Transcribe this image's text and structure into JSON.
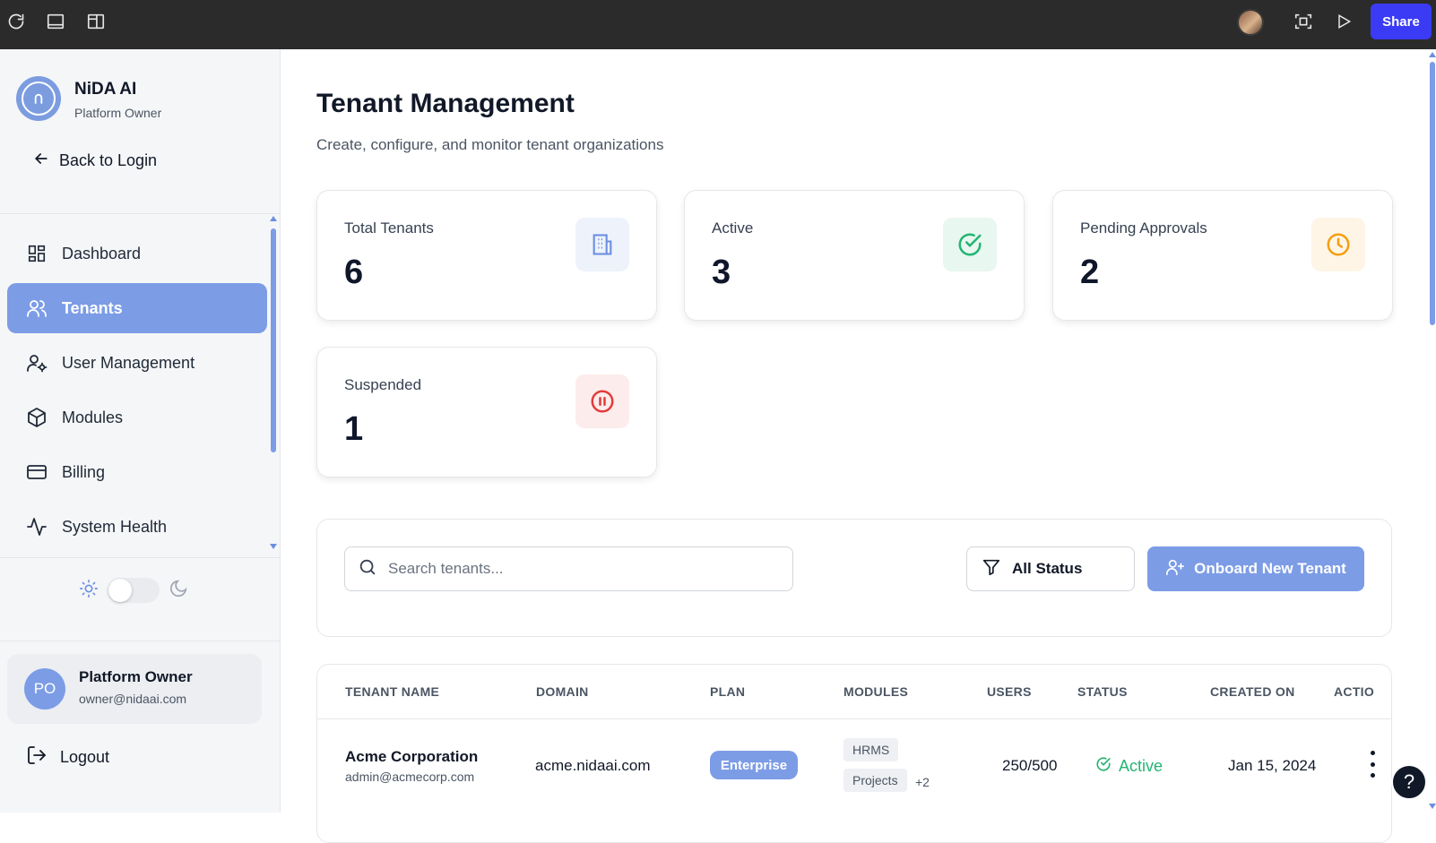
{
  "topbar": {
    "share_label": "Share",
    "icons": [
      "reload-icon",
      "panel-icon",
      "layout-icon",
      "profile-avatar",
      "screenshot-icon",
      "play-icon"
    ]
  },
  "sidebar": {
    "brand_name": "NiDA AI",
    "brand_role": "Platform Owner",
    "back_label": "Back to Login",
    "items": [
      {
        "label": "Dashboard",
        "icon": "dashboard-icon",
        "active": false
      },
      {
        "label": "Tenants",
        "icon": "users-icon",
        "active": true
      },
      {
        "label": "User Management",
        "icon": "user-gear-icon",
        "active": false
      },
      {
        "label": "Modules",
        "icon": "box-icon",
        "active": false
      },
      {
        "label": "Billing",
        "icon": "credit-card-icon",
        "active": false
      },
      {
        "label": "System Health",
        "icon": "activity-icon",
        "active": false
      }
    ],
    "theme": "light",
    "user": {
      "initials": "PO",
      "name": "Platform Owner",
      "email": "owner@nidaai.com"
    },
    "logout_label": "Logout"
  },
  "main": {
    "title": "Tenant Management",
    "subtitle": "Create, configure, and monitor tenant organizations",
    "stats": [
      {
        "label": "Total Tenants",
        "value": "6",
        "icon": "building-icon",
        "color": "#6b8fe0",
        "bg": "#eef2fb"
      },
      {
        "label": "Active",
        "value": "3",
        "icon": "check-circle-icon",
        "color": "#22b573",
        "bg": "#e8f7f0"
      },
      {
        "label": "Pending Approvals",
        "value": "2",
        "icon": "clock-icon",
        "color": "#f59e0b",
        "bg": "#fef5e7"
      },
      {
        "label": "Suspended",
        "value": "1",
        "icon": "pause-circle-icon",
        "color": "#e23b3b",
        "bg": "#fdecec"
      }
    ],
    "search": {
      "placeholder": "Search tenants...",
      "value": ""
    },
    "status_filter": "All Status",
    "onboard_label": "Onboard New Tenant",
    "table": {
      "columns": [
        "TENANT NAME",
        "DOMAIN",
        "PLAN",
        "MODULES",
        "USERS",
        "STATUS",
        "CREATED ON",
        "ACTIO"
      ],
      "rows": [
        {
          "name": "Acme Corporation",
          "email": "admin@acmecorp.com",
          "domain": "acme.nidaai.com",
          "plan": "Enterprise",
          "modules": [
            "HRMS",
            "Projects"
          ],
          "modules_more": "+2",
          "users": "250/500",
          "status": "Active",
          "created": "Jan 15, 2024"
        }
      ]
    }
  },
  "help_label": "?"
}
